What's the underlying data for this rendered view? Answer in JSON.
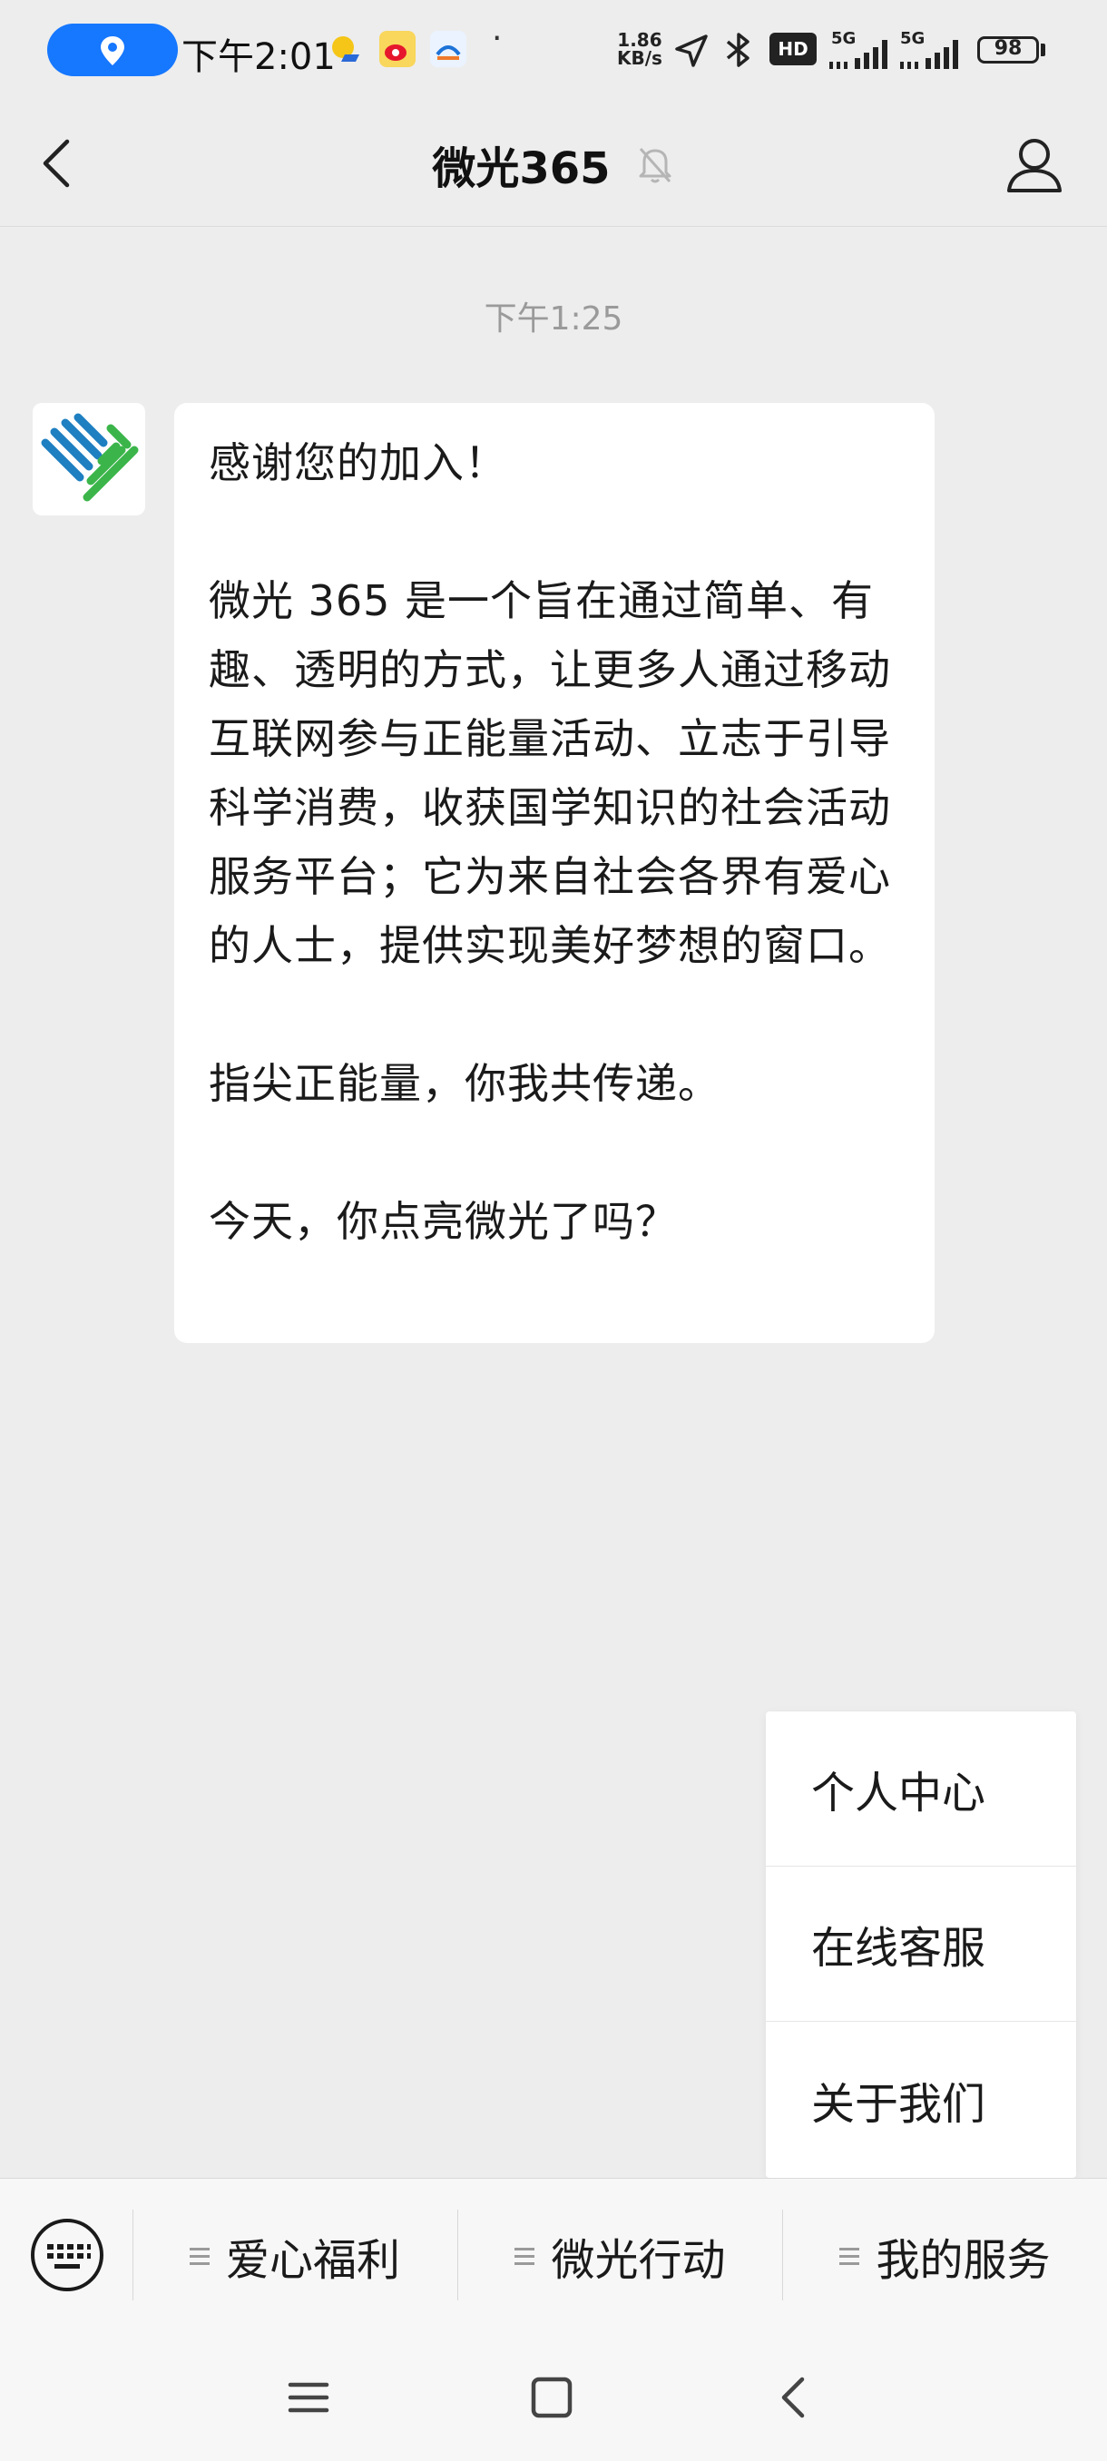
{
  "status_bar": {
    "time": "下午2:01",
    "net_speed_value": "1.86",
    "net_speed_unit": "KB/s",
    "hd_label": "HD",
    "signal_label_1": "5G",
    "signal_label_2": "5G",
    "battery": "98",
    "icons": [
      "location-icon",
      "weather-icon",
      "weibo-icon",
      "app-icon",
      "location-arrow-icon",
      "bluetooth-icon",
      "hd-icon",
      "signal-icon",
      "battery-icon"
    ]
  },
  "header": {
    "title": "微光365",
    "icons": [
      "back-arrow-icon",
      "mute-bell-icon",
      "profile-icon"
    ]
  },
  "chat": {
    "timestamp": "下午1:25",
    "message": {
      "line1": "感谢您的加入！",
      "para2": "微光 365 是一个旨在通过简单、有趣、透明的方式，让更多人通过移动互联网参与正能量活动、立志于引导科学消费，收获国学知识的社会活动服务平台；它为来自社会各界有爱心的人士，提供实现美好梦想的窗口。",
      "para3": "指尖正能量，你我共传递。",
      "para4": "今天，你点亮微光了吗？"
    },
    "colors": {
      "avatar_blue": "#1e7fc1",
      "avatar_green": "#3bb54a"
    }
  },
  "popup_menu": {
    "items": [
      "个人中心",
      "在线客服",
      "关于我们"
    ]
  },
  "bottom_menu": {
    "tabs": [
      "爱心福利",
      "微光行动",
      "我的服务"
    ],
    "icons": [
      "keyboard-icon",
      "menu-lines-icon"
    ]
  },
  "nav_bar": {
    "icons": [
      "menu-icon",
      "home-icon",
      "back-icon"
    ]
  },
  "colors": {
    "background": "#ededed",
    "bubble": "#ffffff",
    "accent_blue": "#1677ff"
  }
}
